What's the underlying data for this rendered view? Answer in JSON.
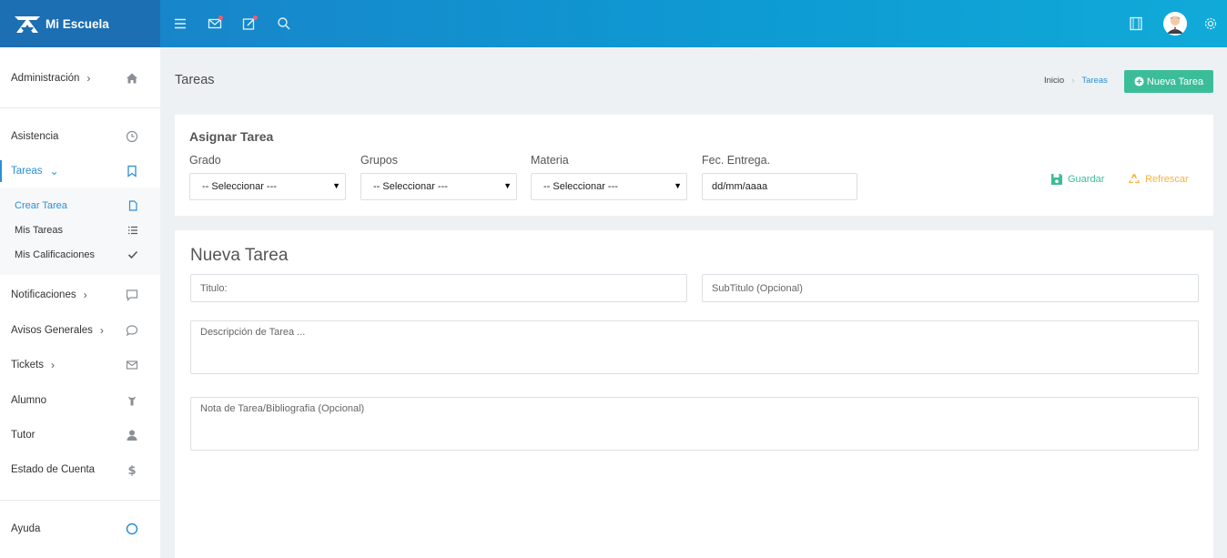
{
  "app": {
    "brand_name": "Mi Escuela"
  },
  "topbar": {
    "icons": [
      "menu-icon",
      "mail-icon",
      "edit-icon",
      "search-icon"
    ],
    "right_icons": [
      "fullscreen-icon",
      "avatar",
      "gear-icon"
    ]
  },
  "sidebar": {
    "items": [
      {
        "label": "Administración",
        "icon": "home-icon",
        "has_chevron": true
      },
      {
        "label": "Asistencia",
        "icon": "clock-icon"
      },
      {
        "label": "Tareas",
        "icon": "bookmark-icon",
        "active": true,
        "expanded": true
      },
      {
        "label": "Notificaciones",
        "icon": "chat-square-icon",
        "has_chevron": true
      },
      {
        "label": "Avisos Generales",
        "icon": "chat-bubble-icon",
        "has_chevron": true
      },
      {
        "label": "Tickets",
        "icon": "envelope-icon",
        "has_chevron": true
      },
      {
        "label": "Alumno",
        "icon": "student-icon"
      },
      {
        "label": "Tutor",
        "icon": "user-icon"
      },
      {
        "label": "Estado de Cuenta",
        "icon": "dollar-icon"
      },
      {
        "label": "Ayuda",
        "icon": "circle-icon"
      }
    ],
    "sub_items": [
      {
        "label": "Crear Tarea",
        "icon": "file-icon",
        "active": true
      },
      {
        "label": "Mis Tareas",
        "icon": "list-icon"
      },
      {
        "label": "Mis Calificaciones",
        "icon": "check-icon"
      }
    ]
  },
  "page": {
    "title": "Tareas",
    "breadcrumb": [
      "Inicio",
      "Tareas"
    ],
    "new_button_label": "Nueva Tarea"
  },
  "assign": {
    "title": "Asignar Tarea",
    "fields": [
      {
        "label": "Grado",
        "value": "-- Seleccionar ---"
      },
      {
        "label": "Grupos",
        "value": "-- Seleccionar ---"
      },
      {
        "label": "Materia",
        "value": "-- Seleccionar ---"
      }
    ],
    "date_label": "Fec. Entrega.",
    "date_value": "dd/mm/aaaa",
    "save_label": "Guardar",
    "refresh_label": "Refrescar",
    "colors": {
      "save": "#3cbd9a",
      "refresh": "#f5b342"
    }
  },
  "new_task": {
    "title": "Nueva Tarea",
    "title_placeholder": "Titulo:",
    "subtitle_placeholder": "SubTitulo (Opcional)",
    "description_placeholder": "Descripción de Tarea ...",
    "note_placeholder": "Nota de Tarea/Bibliografia (Opcional)"
  },
  "colors": {
    "accent": "#2b8fd6",
    "success": "#3cbd9a",
    "topbar": "#0e9ad3"
  }
}
